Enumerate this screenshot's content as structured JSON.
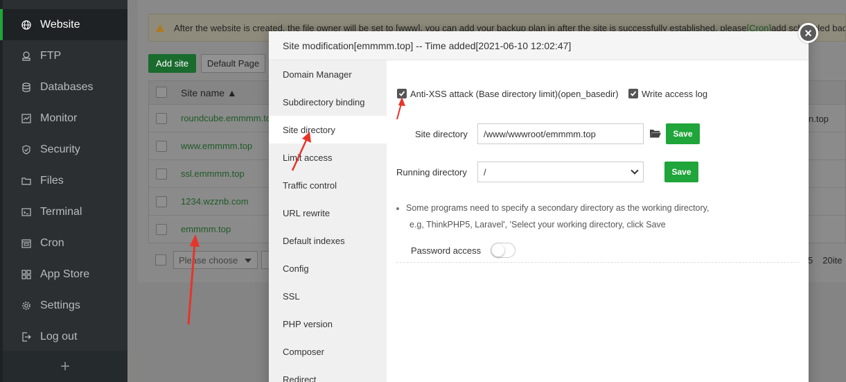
{
  "sidebar": {
    "items": [
      {
        "label": "Website",
        "icon": "globe-icon",
        "active": true
      },
      {
        "label": "FTP",
        "icon": "ftp-icon"
      },
      {
        "label": "Databases",
        "icon": "database-icon"
      },
      {
        "label": "Monitor",
        "icon": "monitor-icon"
      },
      {
        "label": "Security",
        "icon": "shield-icon"
      },
      {
        "label": "Files",
        "icon": "folder-icon"
      },
      {
        "label": "Terminal",
        "icon": "terminal-icon"
      },
      {
        "label": "Cron",
        "icon": "calendar-icon"
      },
      {
        "label": "App Store",
        "icon": "grid-icon"
      },
      {
        "label": "Settings",
        "icon": "gear-icon"
      },
      {
        "label": "Log out",
        "icon": "logout-icon"
      }
    ],
    "add_symbol": "+"
  },
  "notice": {
    "text_before": "After the website is created, the file owner will be set to [www], you can add your backup plan in after the site is successfully established, please",
    "cron_link": "[Cron]",
    "text_after": "add scheduled back"
  },
  "toolbar": {
    "add_site": "Add site",
    "default_page": "Default Page"
  },
  "table": {
    "header_name": "Site name ▲",
    "rows": [
      "roundcube.emmmm.to",
      "www.emmmm.top",
      "ssl.emmmm.top",
      "1234.wzznb.com",
      "emmmm.top"
    ],
    "right_fragment": "n.top"
  },
  "pager": {
    "select_placeholder": "Please choose",
    "page_number": "5",
    "per_page": "20ite"
  },
  "modal": {
    "title": "Site modification[emmmm.top] -- Time added[2021-06-10 12:02:47]",
    "close_symbol": "×",
    "tabs": [
      "Domain Manager",
      "Subdirectory binding",
      "Site directory",
      "Limit access",
      "Traffic control",
      "URL rewrite",
      "Default indexes",
      "Config",
      "SSL",
      "PHP version",
      "Composer",
      "Redirect"
    ],
    "active_tab": "Site directory",
    "site_dir": {
      "anti_xss_label": "Anti-XSS attack (Base directory limit)(open_basedir)",
      "anti_xss_checked": true,
      "write_log_label": "Write access log",
      "write_log_checked": true,
      "site_directory_label": "Site directory",
      "site_directory_value": "/www/wwwroot/emmmm.top",
      "running_directory_label": "Running directory",
      "running_directory_value": "/",
      "save_label": "Save",
      "tip_line1": "Some programs need to specify a secondary directory as the working directory,",
      "tip_line2": "e.g, ThinkPHP5, Laravel', 'Select your working directory, click Save",
      "password_access_label": "Password access",
      "password_access_enabled": false
    }
  },
  "colors": {
    "accent_green": "#20a53a",
    "arrow_red": "#e8332a",
    "sidebar_bg": "#2b2f31"
  }
}
